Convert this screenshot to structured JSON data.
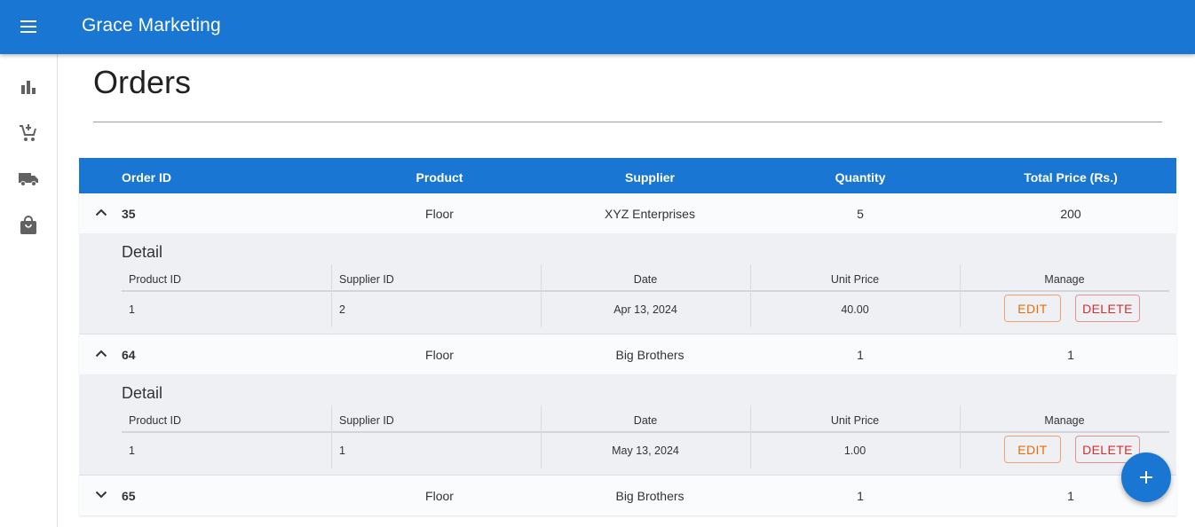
{
  "app": {
    "title": "Grace Marketing",
    "menu_icon": "menu-icon"
  },
  "sidebar": {
    "items": [
      {
        "icon": "bar-chart-icon"
      },
      {
        "icon": "add-cart-icon"
      },
      {
        "icon": "truck-icon"
      },
      {
        "icon": "shopping-bag-icon"
      }
    ]
  },
  "page": {
    "title": "Orders"
  },
  "table": {
    "columns": [
      "Order ID",
      "Product",
      "Supplier",
      "Quantity",
      "Total Price (Rs.)"
    ],
    "orders": [
      {
        "id": "35",
        "product": "Floor",
        "supplier": "XYZ Enterprises",
        "quantity": "5",
        "total": "200",
        "expanded": true,
        "detail": {
          "title": "Detail",
          "product_id": "1",
          "supplier_id": "2",
          "date": "Apr 13, 2024",
          "unit_price": "40.00"
        }
      },
      {
        "id": "64",
        "product": "Floor",
        "supplier": "Big Brothers",
        "quantity": "1",
        "total": "1",
        "expanded": true,
        "detail": {
          "title": "Detail",
          "product_id": "1",
          "supplier_id": "1",
          "date": "May 13, 2024",
          "unit_price": "1.00"
        }
      },
      {
        "id": "65",
        "product": "Floor",
        "supplier": "Big Brothers",
        "quantity": "1",
        "total": "1",
        "expanded": false
      }
    ],
    "detail_columns": [
      "Product ID",
      "Supplier ID",
      "Date",
      "Unit Price",
      "Manage"
    ],
    "edit_label": "EDIT",
    "delete_label": "DELETE"
  },
  "fab": {
    "icon": "plus-icon"
  },
  "colors": {
    "primary": "#1976d2",
    "edit": "#ed6c02",
    "delete": "#d32f2f"
  }
}
